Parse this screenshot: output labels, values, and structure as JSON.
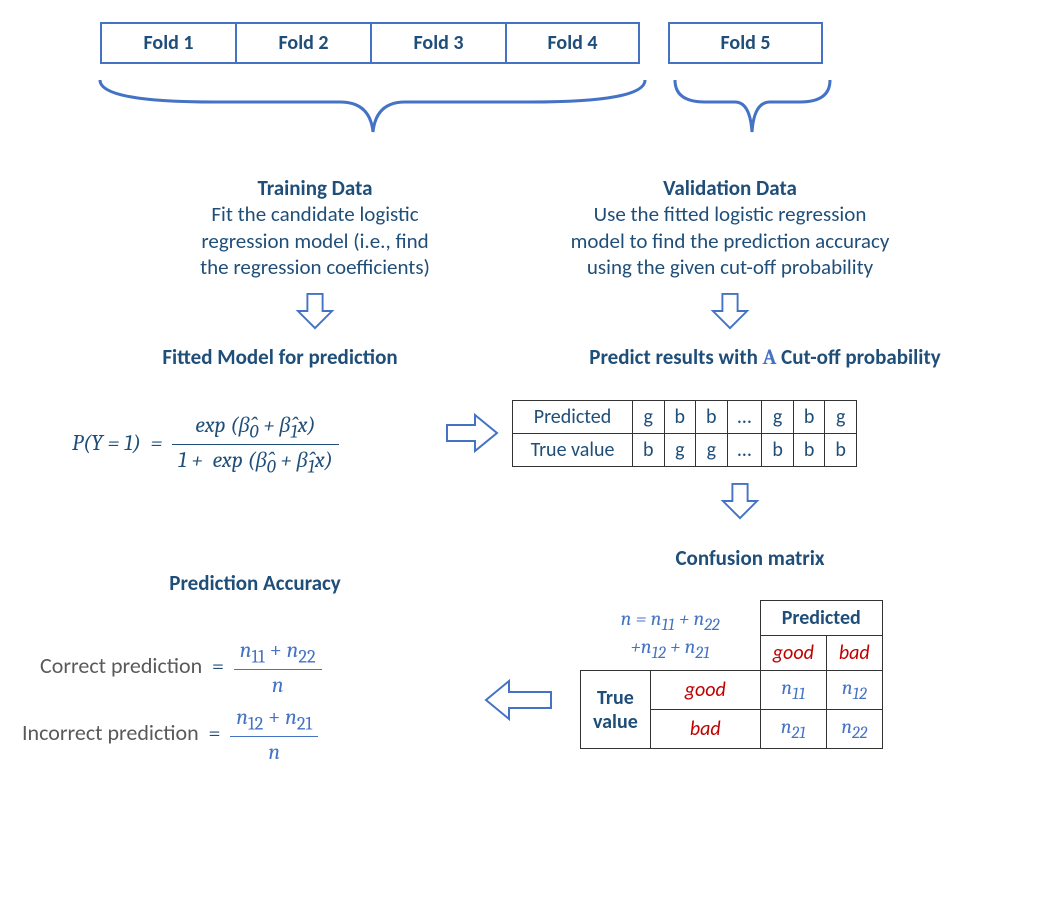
{
  "folds": [
    "Fold 1",
    "Fold 2",
    "Fold 3",
    "Fold 4",
    "Fold 5"
  ],
  "training": {
    "heading": "Training Data",
    "line1": "Fit the candidate logistic",
    "line2": "regression model (i.e., find",
    "line3": "the regression coefficients)"
  },
  "validation": {
    "heading": "Validation Data",
    "line1": "Use the fitted logistic regression",
    "line2": "model to find the prediction accuracy",
    "line3": "using the given cut-off probability"
  },
  "fitted_heading": "Fitted Model for prediction",
  "predict_heading_1": "Predict results with ",
  "predict_heading_A": "A",
  "predict_heading_2": " Cut-off probability",
  "formula": {
    "lhs": "P(Y = 1) =",
    "num": "exp (β̂₀ + β̂₁x)",
    "den": "1 +  exp (β̂₀ + β̂₁x)"
  },
  "result_table": {
    "row1_label": "Predicted",
    "row2_label": "True value",
    "row1": [
      "g",
      "b",
      "b",
      "…",
      "g",
      "b",
      "g"
    ],
    "row2": [
      "b",
      "g",
      "g",
      "…",
      "b",
      "b",
      "b"
    ]
  },
  "confusion_heading": "Confusion matrix",
  "confusion": {
    "n_formula_1": "n = n₁₁ + n₂₂",
    "n_formula_2": "+n₁₂ + n₂₁",
    "predicted": "Predicted",
    "good": "good",
    "bad": "bad",
    "true_value_1": "True",
    "true_value_2": "value",
    "n11": "n₁₁",
    "n12": "n₁₂",
    "n21": "n₂₁",
    "n22": "n₂₂"
  },
  "accuracy_heading": "Prediction Accuracy",
  "correct": {
    "label": "Correct prediction  =",
    "num": "n₁₁ + n₂₂",
    "den": "n"
  },
  "incorrect": {
    "label": "Incorrect prediction  =",
    "num": "n₁₂ + n₂₁",
    "den": "n"
  }
}
